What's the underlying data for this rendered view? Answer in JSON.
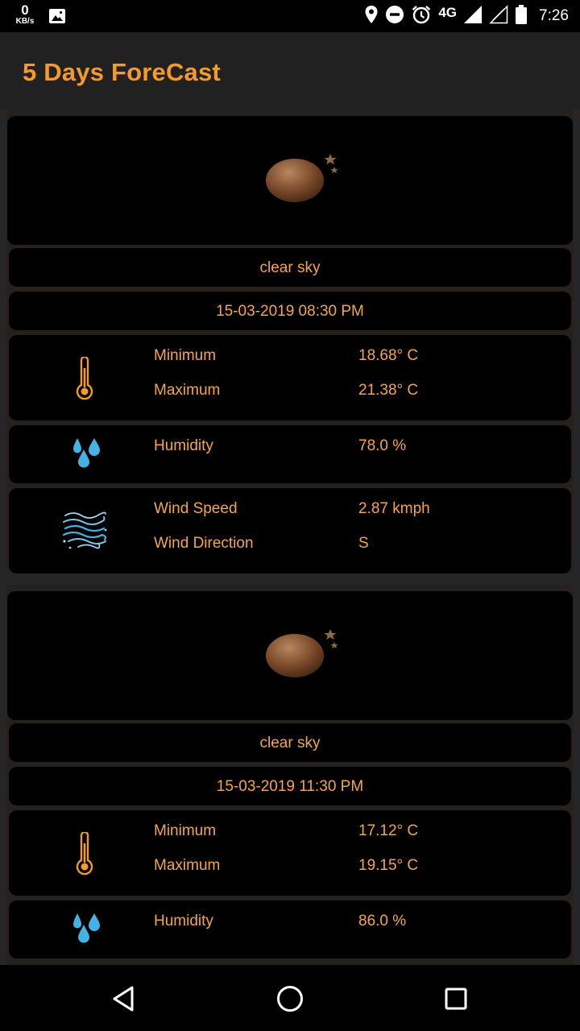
{
  "status_bar": {
    "speed_value": "0",
    "speed_unit": "KB/s",
    "network": "4G",
    "time": "7:26",
    "icons": [
      "gallery-icon",
      "location-icon",
      "do-not-disturb-icon",
      "alarm-icon",
      "signal-icon",
      "signal-empty-icon",
      "battery-icon"
    ]
  },
  "app_bar": {
    "title": "5 Days ForeCast"
  },
  "forecasts": [
    {
      "weather_icon": "clear-sky-night-icon",
      "description": "clear sky",
      "datetime": "15-03-2019 08:30 PM",
      "min_label": "Minimum",
      "min_value": "18.68° C",
      "max_label": "Maximum",
      "max_value": "21.38° C",
      "humidity_label": "Humidity",
      "humidity_value": "78.0 %",
      "wind_speed_label": "Wind Speed",
      "wind_speed_value": "2.87 kmph",
      "wind_direction_label": "Wind Direction",
      "wind_direction_value": "S"
    },
    {
      "weather_icon": "clear-sky-night-icon",
      "description": "clear sky",
      "datetime": "15-03-2019 11:30 PM",
      "min_label": "Minimum",
      "min_value": "17.12° C",
      "max_label": "Maximum",
      "max_value": "19.15° C",
      "humidity_label": "Humidity",
      "humidity_value": "86.0 %"
    }
  ],
  "nav_bar": {
    "buttons": [
      "back-icon",
      "home-icon",
      "recents-icon"
    ]
  },
  "colors": {
    "accent": "#f39a2e",
    "text": "#f6a54c",
    "panel": "#000000",
    "background": "#262626",
    "water": "#45b2e6"
  }
}
